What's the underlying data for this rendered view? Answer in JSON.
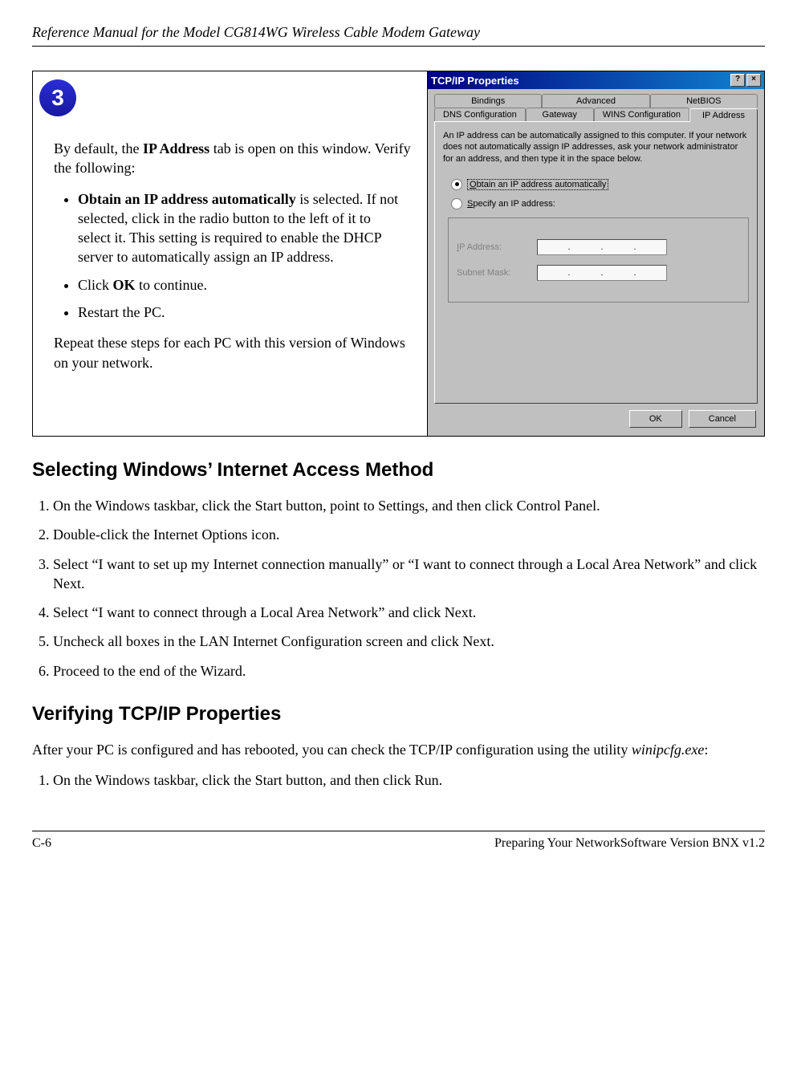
{
  "header": {
    "title": "Reference Manual for the Model CG814WG Wireless Cable Modem Gateway"
  },
  "step": {
    "number": "3"
  },
  "left": {
    "intro_a": "By default, the ",
    "intro_bold": "IP Address",
    "intro_b": " tab is open on this window. Verify the following:",
    "bullet1_bold": "Obtain an IP address automatically",
    "bullet1_rest": " is selected. If not selected, click in the radio button to the left of it to select it. This setting is required to enable the DHCP server to automatically assign an IP address.",
    "bullet2_a": "Click ",
    "bullet2_bold": "OK",
    "bullet2_b": " to continue.",
    "bullet3": "Restart the PC.",
    "outro": "Repeat these steps for each PC with this version of Windows on your network."
  },
  "dialog": {
    "title": "TCP/IP Properties",
    "help_btn": "?",
    "close_btn": "×",
    "tabs_back": {
      "bindings": "Bindings",
      "advanced": "Advanced",
      "netbios": "NetBIOS"
    },
    "tabs_front": {
      "dns": "DNS Configuration",
      "gateway": "Gateway",
      "wins": "WINS Configuration",
      "ip": "IP Address"
    },
    "desc": "An IP address can be automatically assigned to this computer. If your network does not automatically assign IP addresses, ask your network administrator for an address, and then type it in the space below.",
    "radio_obtain": "Obtain an IP address automatically",
    "radio_specify": "Specify an IP address:",
    "field_ip": "IP Address:",
    "field_mask": "Subnet Mask:",
    "ok": "OK",
    "cancel": "Cancel"
  },
  "section1": {
    "title": "Selecting Windows’ Internet Access Method",
    "items": [
      "On the Windows taskbar, click the Start button, point to Settings, and then click Control Panel.",
      "Double-click the Internet Options icon.",
      "Select “I want to set up my Internet connection manually” or “I want to connect through a Local Area Network” and click Next.",
      "Select “I want to connect through a Local Area Network” and click Next.",
      "Uncheck all boxes in the LAN Internet Configuration screen and click Next.",
      "Proceed to the end of the Wizard."
    ]
  },
  "section2": {
    "title": "Verifying TCP/IP Properties",
    "para_a": "After your PC is configured and has rebooted, you can check the TCP/IP configuration using the utility ",
    "para_italic": "winipcfg.exe",
    "para_b": ":",
    "items": [
      "On the Windows taskbar, click the Start button, and then click Run."
    ]
  },
  "footer": {
    "left": "C-6",
    "right": "Preparing Your NetworkSoftware Version BNX v1.2"
  }
}
